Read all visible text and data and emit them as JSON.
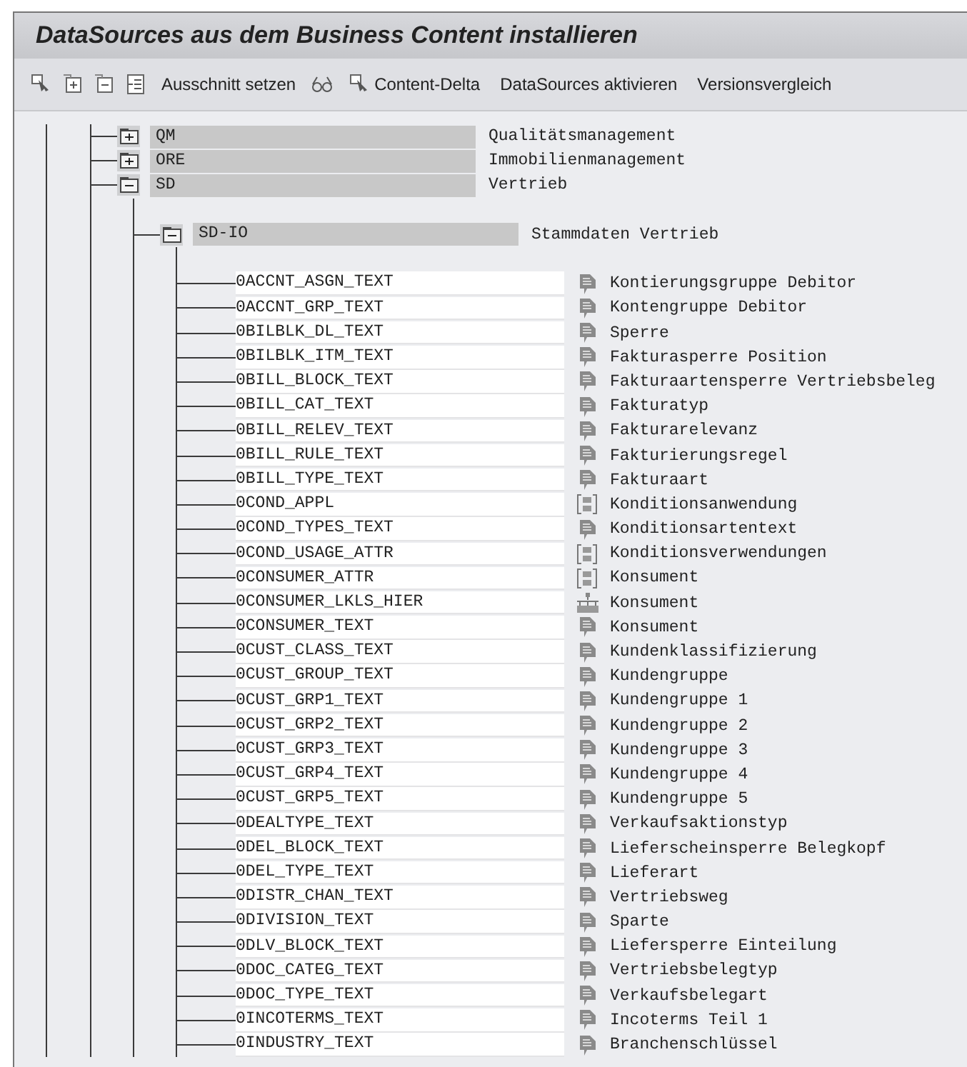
{
  "window": {
    "title": "DataSources aus dem Business Content installieren"
  },
  "toolbar": [
    {
      "kind": "icon"
    },
    {
      "kind": "icon"
    },
    {
      "kind": "icon"
    },
    {
      "kind": "icon"
    },
    {
      "kind": "text",
      "label": "Ausschnitt setzen"
    },
    {
      "kind": "icon"
    },
    {
      "kind": "icontext",
      "label": "Content-Delta"
    },
    {
      "kind": "text",
      "label": "DataSources aktivieren"
    },
    {
      "kind": "text",
      "label": "Versionsvergleich"
    }
  ],
  "tree": [
    {
      "code": "QM",
      "description": "Qualitätsmanagement",
      "expanded": false
    },
    {
      "code": "ORE",
      "description": "Immobilienmanagement",
      "expanded": false
    },
    {
      "code": "SD",
      "description": "Vertrieb",
      "expanded": true,
      "children": [
        {
          "code": "SD-IO",
          "description": "Stammdaten Vertrieb",
          "expanded": true,
          "children": [
            {
              "kind": "text",
              "code": "0ACCNT_ASGN_TEXT",
              "description": "Kontierungsgruppe Debitor"
            },
            {
              "kind": "text",
              "code": "0ACCNT_GRP_TEXT",
              "description": "Kontengruppe Debitor"
            },
            {
              "kind": "text",
              "code": "0BILBLK_DL_TEXT",
              "description": "Sperre"
            },
            {
              "kind": "text",
              "code": "0BILBLK_ITM_TEXT",
              "description": "Fakturasperre Position"
            },
            {
              "kind": "text",
              "code": "0BILL_BLOCK_TEXT",
              "description": "Fakturaartensperre Vertriebsbeleg"
            },
            {
              "kind": "text",
              "code": "0BILL_CAT_TEXT",
              "description": "Fakturatyp"
            },
            {
              "kind": "text",
              "code": "0BILL_RELEV_TEXT",
              "description": "Fakturarelevanz"
            },
            {
              "kind": "text",
              "code": "0BILL_RULE_TEXT",
              "description": "Fakturierungsregel"
            },
            {
              "kind": "text",
              "code": "0BILL_TYPE_TEXT",
              "description": "Fakturaart"
            },
            {
              "kind": "attr",
              "code": "0COND_APPL",
              "description": "Konditionsanwendung"
            },
            {
              "kind": "text",
              "code": "0COND_TYPES_TEXT",
              "description": "Konditionsartentext"
            },
            {
              "kind": "attr",
              "code": "0COND_USAGE_ATTR",
              "description": "Konditionsverwendungen"
            },
            {
              "kind": "attr",
              "code": "0CONSUMER_ATTR",
              "description": "Konsument"
            },
            {
              "kind": "hier",
              "code": "0CONSUMER_LKLS_HIER",
              "description": "Konsument"
            },
            {
              "kind": "text",
              "code": "0CONSUMER_TEXT",
              "description": "Konsument"
            },
            {
              "kind": "text",
              "code": "0CUST_CLASS_TEXT",
              "description": "Kundenklassifizierung"
            },
            {
              "kind": "text",
              "code": "0CUST_GROUP_TEXT",
              "description": "Kundengruppe"
            },
            {
              "kind": "text",
              "code": "0CUST_GRP1_TEXT",
              "description": "Kundengruppe 1"
            },
            {
              "kind": "text",
              "code": "0CUST_GRP2_TEXT",
              "description": "Kundengruppe 2"
            },
            {
              "kind": "text",
              "code": "0CUST_GRP3_TEXT",
              "description": "Kundengruppe 3"
            },
            {
              "kind": "text",
              "code": "0CUST_GRP4_TEXT",
              "description": "Kundengruppe 4"
            },
            {
              "kind": "text",
              "code": "0CUST_GRP5_TEXT",
              "description": "Kundengruppe 5"
            },
            {
              "kind": "text",
              "code": "0DEALTYPE_TEXT",
              "description": "Verkaufsaktionstyp"
            },
            {
              "kind": "text",
              "code": "0DEL_BLOCK_TEXT",
              "description": "Lieferscheinsperre Belegkopf"
            },
            {
              "kind": "text",
              "code": "0DEL_TYPE_TEXT",
              "description": "Lieferart"
            },
            {
              "kind": "text",
              "code": "0DISTR_CHAN_TEXT",
              "description": "Vertriebsweg"
            },
            {
              "kind": "text",
              "code": "0DIVISION_TEXT",
              "description": "Sparte"
            },
            {
              "kind": "text",
              "code": "0DLV_BLOCK_TEXT",
              "description": "Liefersperre Einteilung"
            },
            {
              "kind": "text",
              "code": "0DOC_CATEG_TEXT",
              "description": "Vertriebsbelegtyp"
            },
            {
              "kind": "text",
              "code": "0DOC_TYPE_TEXT",
              "description": "Verkaufsbelegart"
            },
            {
              "kind": "text",
              "code": "0INCOTERMS_TEXT",
              "description": "Incoterms Teil 1"
            },
            {
              "kind": "text",
              "code": "0INDUSTRY_TEXT",
              "description": "Branchenschlüssel"
            }
          ]
        }
      ]
    }
  ]
}
